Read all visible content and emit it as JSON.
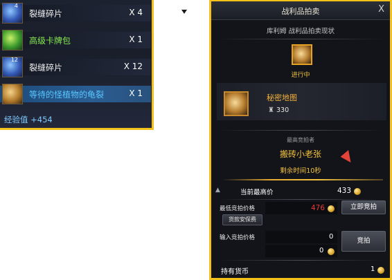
{
  "loot_panel": {
    "rows": [
      {
        "name": "裂缝碎片",
        "qty": "X 4",
        "badge": "4",
        "icon": "crystal-shard-icon"
      },
      {
        "name": "高级卡牌包",
        "qty": "X 1",
        "badge": "",
        "icon": "card-pack-icon"
      },
      {
        "name": "裂缝碎片",
        "qty": "X 12",
        "badge": "12",
        "icon": "crystal-shard-icon"
      },
      {
        "name": "等待的怪植物的龟裂",
        "qty": "X 1",
        "badge": "",
        "icon": "scroll-icon"
      }
    ],
    "exp_label": "经验值 +454"
  },
  "auction": {
    "title": "战利品拍卖",
    "close": "X",
    "subtitle": "库利姆 战利品拍卖现状",
    "status": "进行中",
    "item_name": "秘密地图",
    "item_power": "330",
    "highest_bidder_label": "最高竞拍者",
    "highest_bidder_name": "搬砖小老张",
    "time_left": "剩余时间10秒",
    "current_highest_label": "当前最高价",
    "current_highest_value": "433",
    "min_bid_label": "最低竞拍价格",
    "min_bid_value": "476",
    "bid_now_button": "立即竞拍",
    "secure_payment_button": "货款安保费",
    "input_bid_label": "输入竞拍价格",
    "input_bid_value": "0",
    "input_bid_value2": "0",
    "bid_button": "竞拍",
    "currency_label": "持有货币",
    "currency_value": "1"
  },
  "colors": {
    "frame": "#f2c21a",
    "gold_text": "#f2b13a",
    "red_text": "#e33a3a",
    "exp_text": "#7fcaff"
  }
}
